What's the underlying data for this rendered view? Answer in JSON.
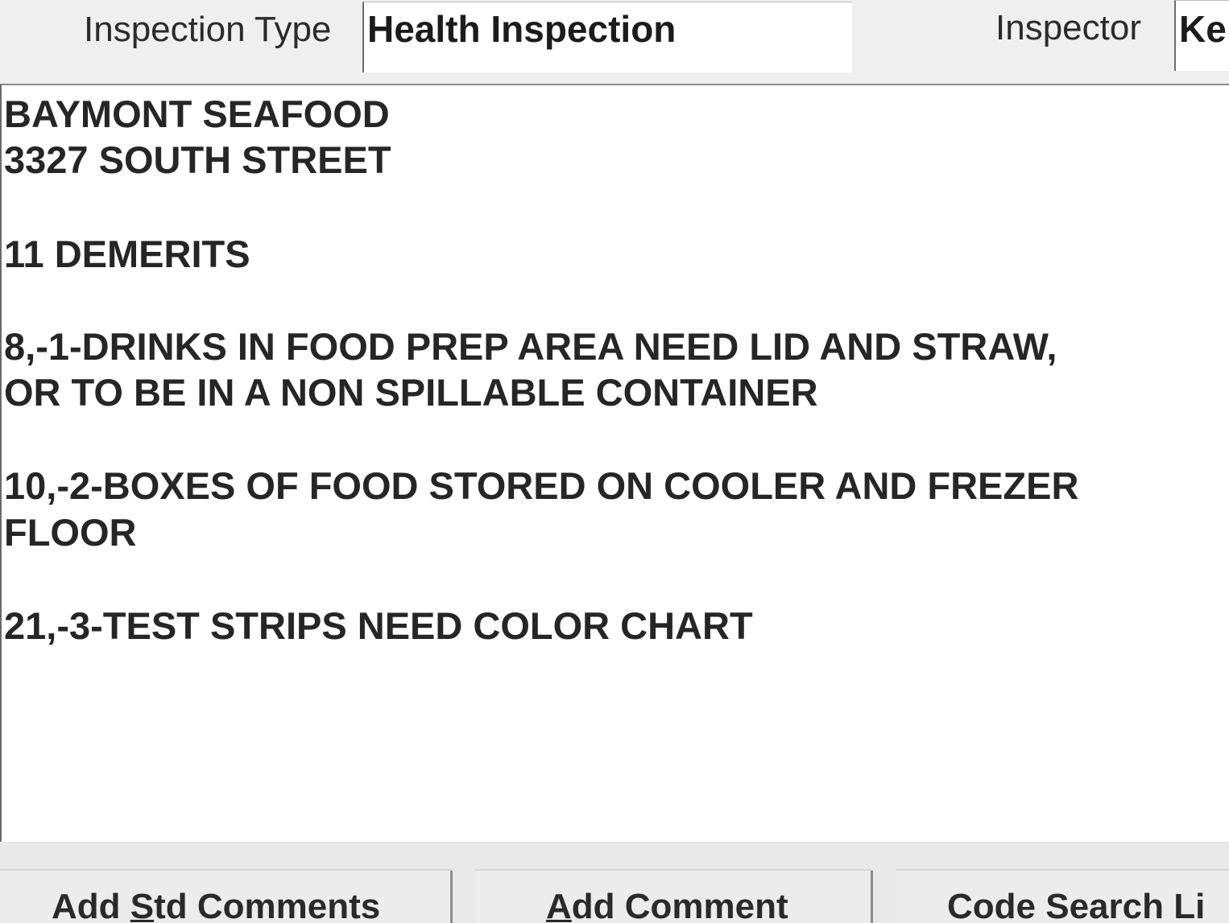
{
  "header": {
    "inspection_type_label": "Inspection Type",
    "inspection_type_value": "Health Inspection",
    "inspector_label": "Inspector",
    "inspector_value": "Ke"
  },
  "notes": {
    "lines": [
      "BAYMONT SEAFOOD",
      "3327 SOUTH STREET",
      "11 DEMERITS",
      "8,-1-DRINKS IN FOOD PREP AREA NEED LID AND STRAW,",
      "OR TO BE IN A NON SPILLABLE CONTAINER",
      "10,-2-BOXES OF FOOD STORED ON COOLER AND FREZER",
      "FLOOR",
      "21,-3-TEST STRIPS NEED COLOR CHART"
    ]
  },
  "buttons": {
    "std_comments": {
      "before": "Add ",
      "mnemonic": "S",
      "after": "td Comments"
    },
    "add_comment": {
      "before": "",
      "mnemonic": "A",
      "after": "dd Comment"
    },
    "code_search": {
      "label": "Code Search Li"
    }
  }
}
